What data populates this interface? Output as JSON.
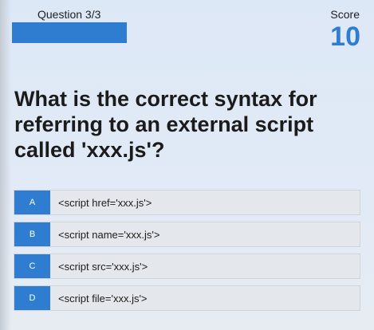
{
  "header": {
    "question_counter": "Question 3/3",
    "progress_fraction": 1.0,
    "score_label": "Score",
    "score_value": "10"
  },
  "question": {
    "text": "What is the correct syntax for referring to an external script called 'xxx.js'?"
  },
  "answers": [
    {
      "letter": "A",
      "text": "<script href='xxx.js'>"
    },
    {
      "letter": "B",
      "text": "<script name='xxx.js'>"
    },
    {
      "letter": "C",
      "text": "<script src='xxx.js'>"
    },
    {
      "letter": "D",
      "text": "<script file='xxx.js'>"
    }
  ],
  "colors": {
    "accent": "#2f7dd1",
    "background": "#dde8f7",
    "answer_background": "#e4e7eb"
  }
}
